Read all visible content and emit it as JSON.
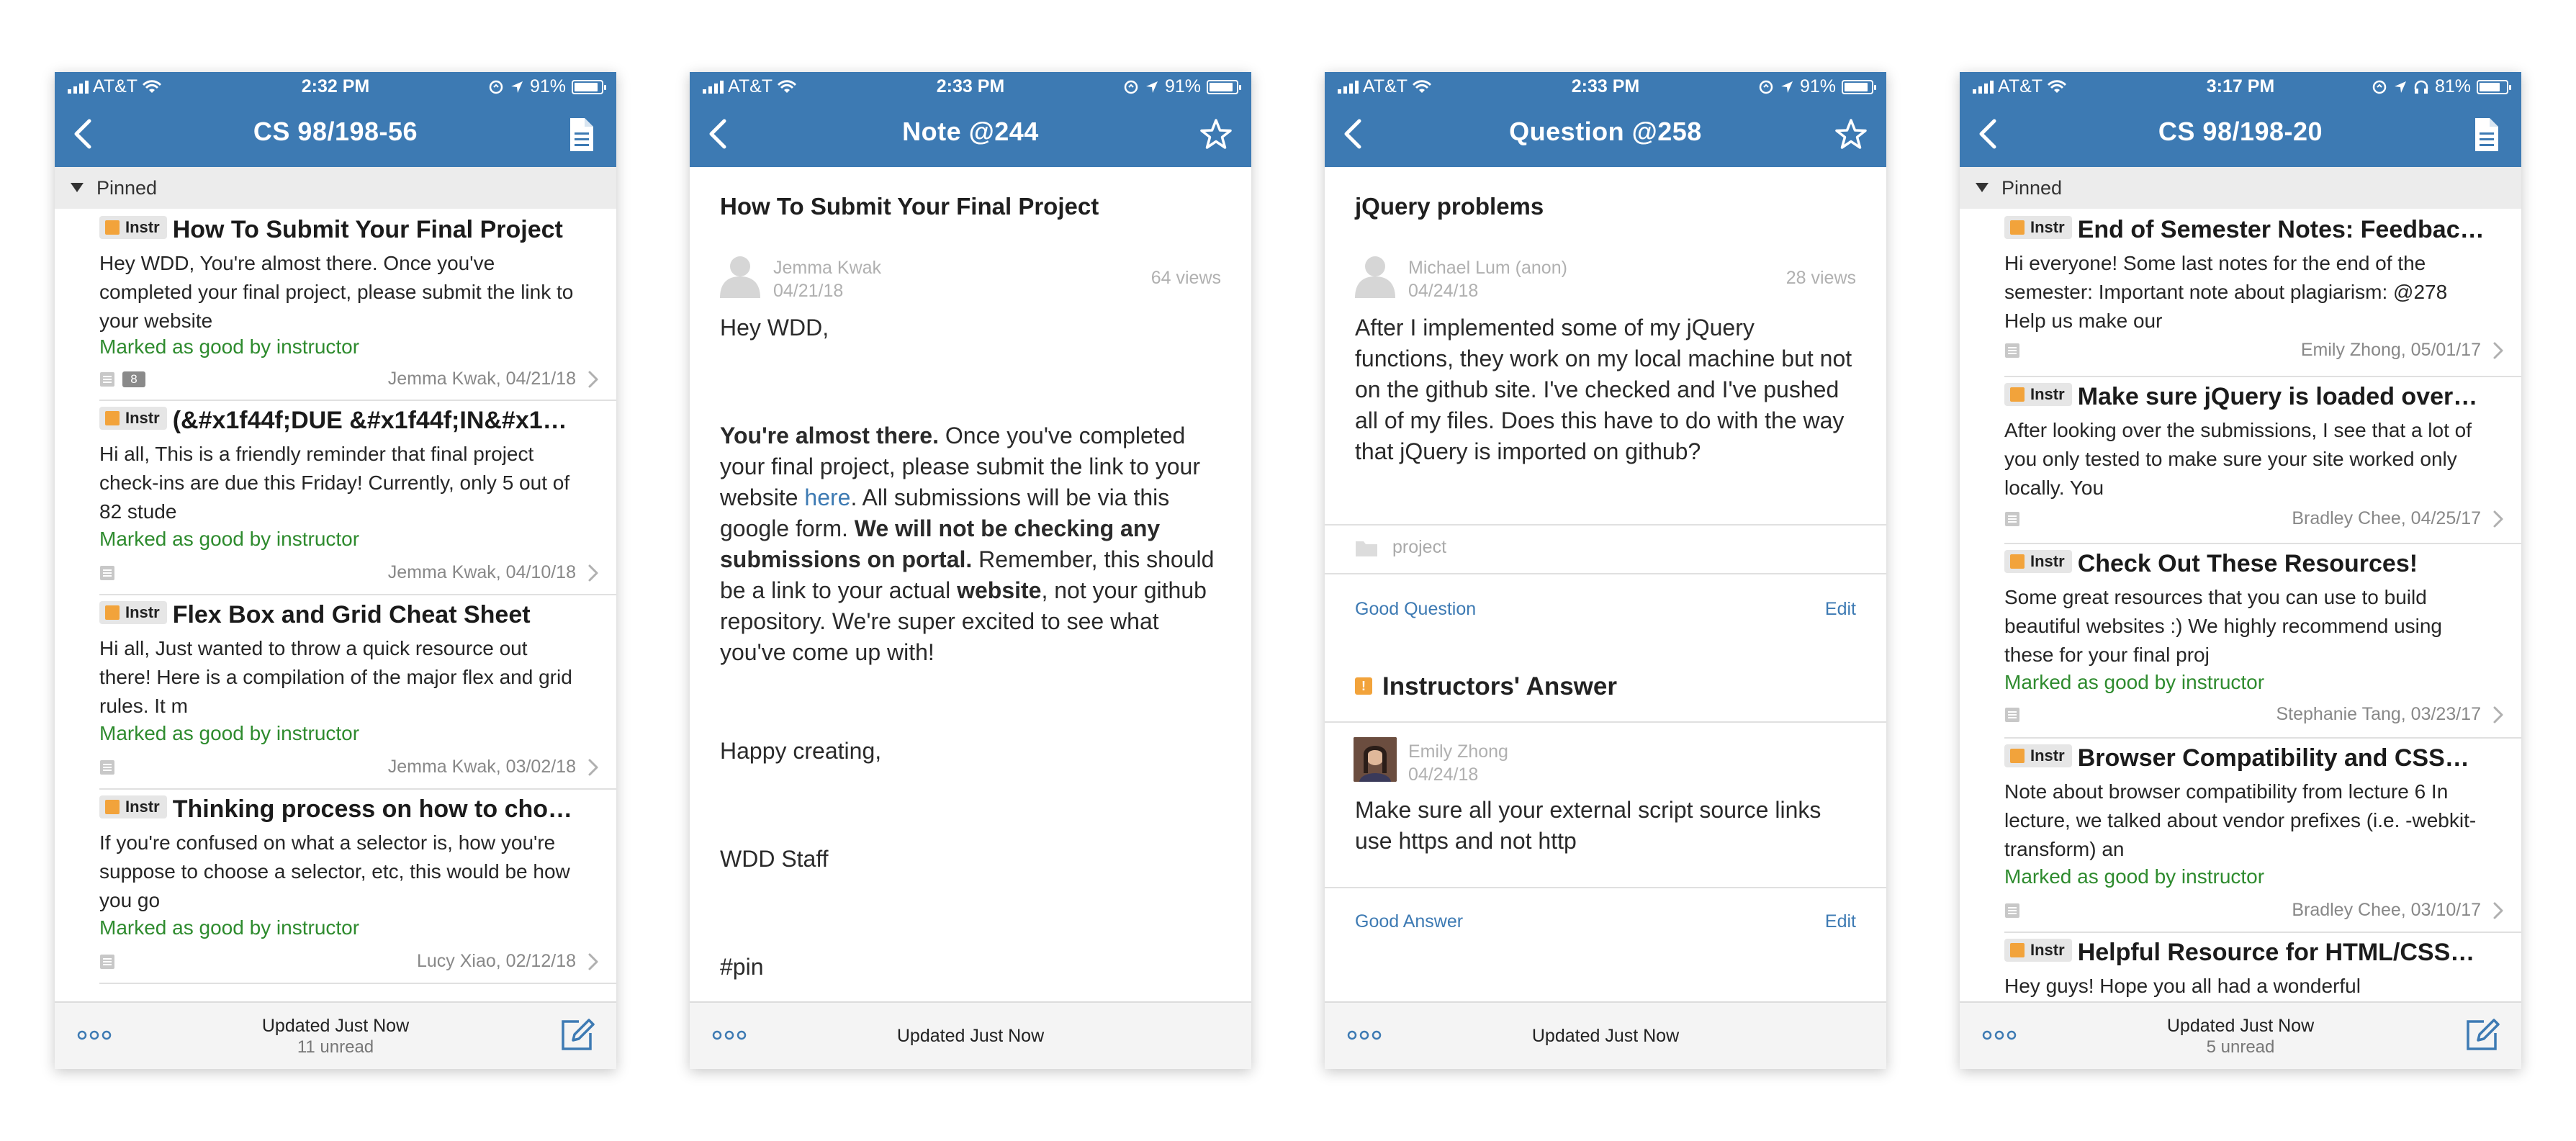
{
  "status_icons": [
    "signal-bars",
    "wifi",
    "orientation-lock",
    "location-arrow",
    "headphones",
    "battery"
  ],
  "colors": {
    "header": "#3d7ab3",
    "badge_square": "#f2a33b",
    "good": "#2e8b2e",
    "link": "#3d7ab3"
  },
  "screen1": {
    "status": {
      "carrier": "AT&T",
      "time": "2:32 PM",
      "battery": "91%",
      "battery_level": 0.91
    },
    "title": "CS 98/198-56",
    "pinned_label": "Pinned",
    "posts": [
      {
        "badge": "Instr",
        "title": "How To Submit Your Final Project",
        "snippet": "Hey WDD, You're almost there. Once you've completed your final project, please submit the link to your website",
        "good": "Marked as good by instructor",
        "count": "8",
        "author": "Jemma Kwak, 04/21/18"
      },
      {
        "badge": "Instr",
        "title": "(&#x1f44f;DUE &#x1f44f;IN&#x1…",
        "snippet": "Hi all, This is a friendly reminder that final project check-ins are due this Friday! Currently, only 5 out of 82 stude",
        "good": "Marked as good by instructor",
        "author": "Jemma Kwak, 04/10/18"
      },
      {
        "badge": "Instr",
        "title": "Flex Box and Grid Cheat Sheet",
        "snippet": "Hi all, Just wanted to throw a quick resource out there! Here is a compilation of the major flex and grid rules. It m",
        "good": "Marked as good by instructor",
        "author": "Jemma Kwak, 03/02/18"
      },
      {
        "badge": "Instr",
        "title": "Thinking process on how to cho…",
        "snippet": "If you're confused on what a selector is, how you're suppose to choose a selector, etc, this would be how you go",
        "good": "Marked as good by instructor",
        "author": "Lucy Xiao, 02/12/18"
      }
    ],
    "footer": {
      "updated": "Updated Just Now",
      "unread": "11 unread"
    }
  },
  "screen2": {
    "status": {
      "carrier": "AT&T",
      "time": "2:33 PM",
      "battery": "91%",
      "battery_level": 0.91
    },
    "title": "Note @244",
    "post_title": "How To Submit Your Final Project",
    "author": "Jemma Kwak",
    "date": "04/21/18",
    "views": "64 views",
    "body": {
      "greeting": "Hey WDD,",
      "p1_bold1": "You're almost there.",
      "p1_text1": " Once you've completed your final project, please submit the link to your website ",
      "p1_link": "here",
      "p1_text2": ". All submissions will be via this google form. ",
      "p1_bold2": "We will not be checking any submissions on portal.",
      "p1_text3": "  Remember, this should be a link to your actual ",
      "p1_bold3": "website",
      "p1_text4": ", not your github repository. We're super excited to see what you've come up with!",
      "closing": "Happy creating,",
      "signature": "WDD Staff",
      "tag": "#pin"
    },
    "footer": {
      "updated": "Updated Just Now"
    }
  },
  "screen3": {
    "status": {
      "carrier": "AT&T",
      "time": "2:33 PM",
      "battery": "91%",
      "battery_level": 0.91
    },
    "title": "Question @258",
    "post_title": "jQuery problems",
    "author": "Michael Lum (anon)",
    "date": "04/24/18",
    "views": "28 views",
    "body": "After I implemented some of my jQuery functions, they work on my local machine but not on the github site. I've checked and I've pushed all of my files. Does this have to do with the way that jQuery is imported on github?",
    "folder": "project",
    "good_question": "Good Question",
    "edit": "Edit",
    "answer_heading": "Instructors' Answer",
    "answer_author": "Emily Zhong",
    "answer_date": "04/24/18",
    "answer_body": "Make sure all your external script source links use https and not http",
    "good_answer": "Good Answer",
    "footer": {
      "updated": "Updated Just Now"
    }
  },
  "screen4": {
    "status": {
      "carrier": "AT&T",
      "time": "3:17 PM",
      "battery": "81%",
      "battery_level": 0.81
    },
    "title": "CS 98/198-20",
    "pinned_label": "Pinned",
    "posts": [
      {
        "badge": "Instr",
        "title": "End of Semester Notes: Feedbac…",
        "snippet": "Hi everyone! Some last notes for the end of the semester: Important note about plagiarism: @278 Help us make our",
        "author": "Emily Zhong, 05/01/17"
      },
      {
        "badge": "Instr",
        "title": "Make sure jQuery is loaded over…",
        "snippet": "After looking over the submissions, I see that a lot of you only tested to make sure your site worked only locally. You",
        "author": "Bradley Chee, 04/25/17"
      },
      {
        "badge": "Instr",
        "title": "Check Out These Resources!",
        "snippet": "Some great resources that you can use to build beautiful websites :) We highly recommend using these for your final proj",
        "good": "Marked as good by instructor",
        "author": "Stephanie Tang, 03/23/17"
      },
      {
        "badge": "Instr",
        "title": "Browser Compatibility and CSS…",
        "snippet": "Note about browser compatibility from lecture 6 In lecture, we talked about vendor prefixes (i.e. -webkit-transform) an",
        "good": "Marked as good by instructor",
        "author": "Bradley Chee, 03/10/17"
      },
      {
        "badge": "Instr",
        "title": "Helpful Resource for HTML/CSS…",
        "snippet": "Hey guys! Hope you all had a wonderful"
      }
    ],
    "footer": {
      "updated": "Updated Just Now",
      "unread": "5 unread"
    }
  }
}
